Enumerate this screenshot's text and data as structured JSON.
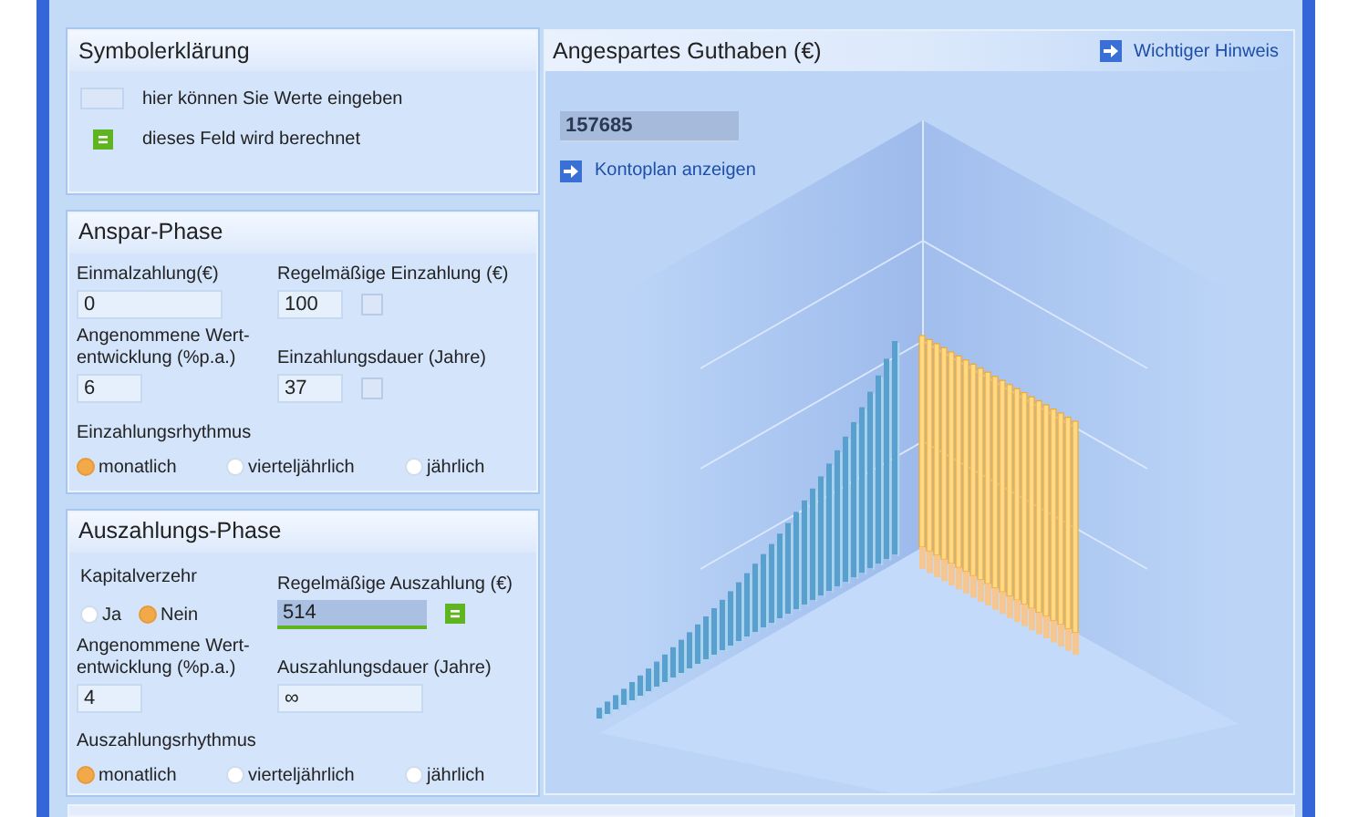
{
  "legend": {
    "title": "Symbolerklärung",
    "items": [
      {
        "kind": "input",
        "label": "hier können Sie Werte eingeben"
      },
      {
        "kind": "calculated",
        "label": "dieses Feld wird berechnet"
      }
    ]
  },
  "savings_phase": {
    "title": "Anspar-Phase",
    "fields": [
      {
        "kind": "plain",
        "label": "Einmalzahlung(€)",
        "value": "0"
      },
      {
        "kind": "checkbox",
        "label": "Regelmäßige Einzahlung (€)",
        "value": "100",
        "checked": false
      },
      {
        "kind": "plain",
        "label": "Angenommene Wert-entwicklung (%p.a.)",
        "value": "6"
      },
      {
        "kind": "checkbox",
        "label": "Einzahlungsdauer (Jahre)",
        "value": "37",
        "checked": false
      }
    ],
    "rhythm": {
      "label": "Einzahlungsrhythmus",
      "options": [
        {
          "label": "monatlich",
          "selected": true
        },
        {
          "label": "vierteljährlich",
          "selected": false
        },
        {
          "label": "jährlich",
          "selected": false
        }
      ]
    }
  },
  "payout_phase": {
    "title": "Auszahlungs-Phase",
    "capital_consumption": {
      "label": "Kapitalverzehr",
      "options": [
        {
          "label": "Ja",
          "selected": false
        },
        {
          "label": "Nein",
          "selected": true
        }
      ]
    },
    "fields": [
      {
        "kind": "calculated",
        "label": "Regelmäßige Auszahlung (€)",
        "value": "514"
      },
      {
        "kind": "plain",
        "label": "Angenommene Wert-entwicklung (%p.a.)",
        "value": "4"
      },
      {
        "kind": "plain",
        "label": "Auszahlungsdauer (Jahre)",
        "value": "∞"
      }
    ],
    "rhythm": {
      "label": "Auszahlungsrhythmus",
      "options": [
        {
          "label": "monatlich",
          "selected": true
        },
        {
          "label": "vierteljährlich",
          "selected": false
        },
        {
          "label": "jährlich",
          "selected": false
        }
      ]
    }
  },
  "result": {
    "title": "Angespartes Guthaben (€)",
    "notice_link": "Wichtiger Hinweis",
    "value": "157685",
    "plan_link": "Kontoplan anzeigen"
  }
}
